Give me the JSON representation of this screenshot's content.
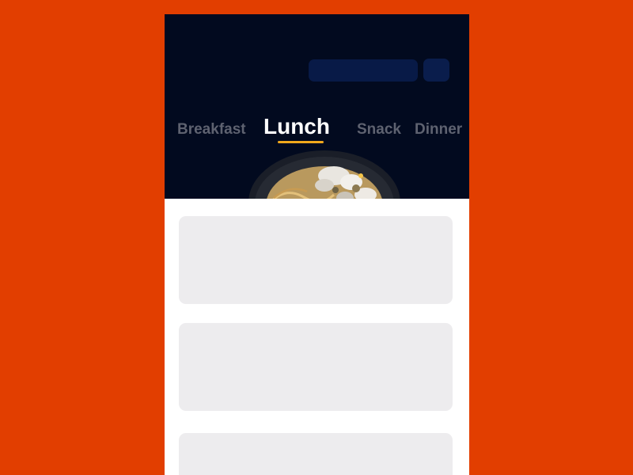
{
  "theme": {
    "backdrop_color": "#E23E00",
    "header_color": "#020A1F",
    "search_pill_color": "#081A47",
    "action_button_color": "#0A1D4C",
    "tab_inactive_color": "#5E6270",
    "tab_active_color": "#FFFFFF",
    "tab_indicator_color": "#F0A81C",
    "card_color": "#EDECEE",
    "content_color": "#FFFFFF"
  },
  "meal_tabs": {
    "items": [
      {
        "label": "Breakfast",
        "active": false
      },
      {
        "label": "Lunch",
        "active": true
      },
      {
        "label": "Snack",
        "active": false
      },
      {
        "label": "Dinner",
        "active": false
      }
    ]
  },
  "hero": {
    "image": "plate-of-noodles-image"
  },
  "cards": [
    {
      "state": "loading-placeholder"
    },
    {
      "state": "loading-placeholder"
    },
    {
      "state": "loading-placeholder"
    }
  ]
}
